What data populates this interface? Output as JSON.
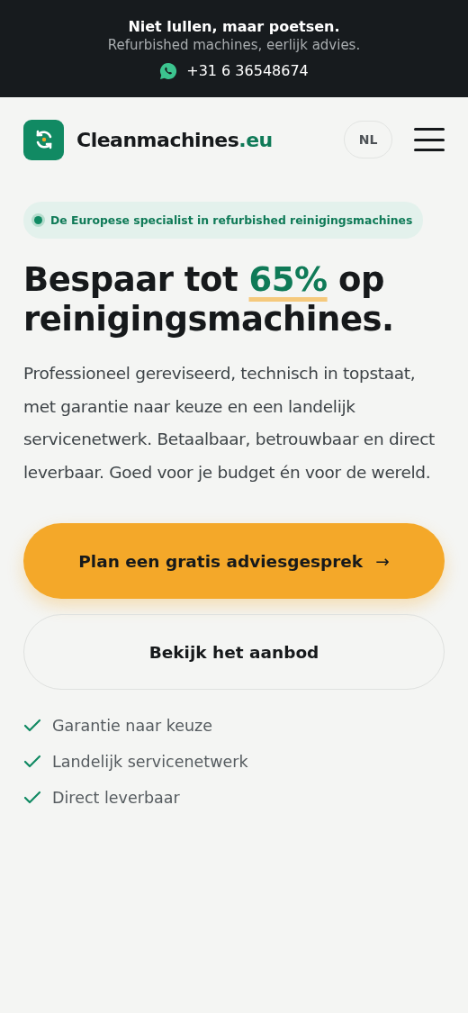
{
  "topbar": {
    "slogan": "Niet lullen, maar poetsen.",
    "tagline": "Refurbished machines, eerlijk advies.",
    "phone": "+31 6 36548674"
  },
  "header": {
    "logo": {
      "name": "Cleanmachines",
      "tld": ".eu"
    },
    "language": "NL"
  },
  "hero": {
    "badge": "De Europese specialist in refurbished reinigingsmachines",
    "headline": {
      "before": "Bespaar tot ",
      "highlight": "65%",
      "after": " op reinigingsmachines."
    },
    "intro": "Professioneel gereviseerd, technisch in topstaat, met garantie naar keuze en een landelijk servicenetwerk. Betaalbaar, betrouwbaar en direct leverbaar. Goed voor je budget én voor de wereld.",
    "buttons": [
      {
        "kind": "primary",
        "label": "Plan een gratis adviesgesprek",
        "arrow": "→"
      },
      {
        "kind": "secondary",
        "label": "Bekijk het aanbod"
      }
    ],
    "benefits": [
      "Garantie naar keuze",
      "Landelijk servicenetwerk",
      "Direct leverbaar"
    ]
  }
}
